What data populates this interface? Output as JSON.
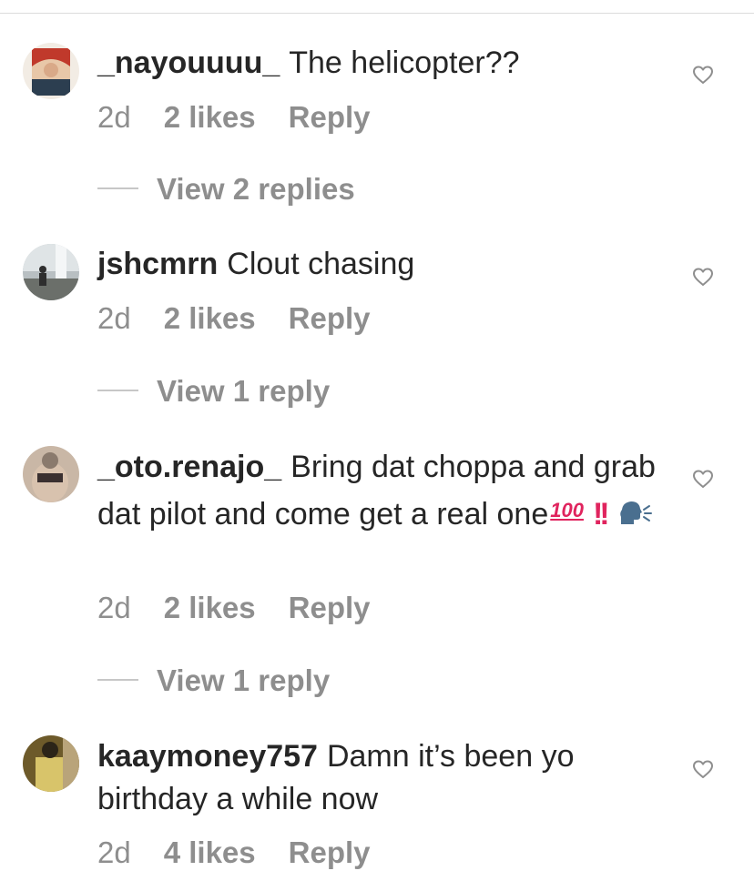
{
  "comments": [
    {
      "username": "_nayouuuu_",
      "text": "The helicopter??",
      "time": "2d",
      "likes": "2 likes",
      "reply": "Reply",
      "view_replies": "View 2 replies",
      "avatar_colors": [
        "#f2ece4",
        "#c0392b",
        "#e8c7a8"
      ]
    },
    {
      "username": "jshcmrn",
      "text": "Clout chasing",
      "time": "2d",
      "likes": "2 likes",
      "reply": "Reply",
      "view_replies": "View 1 reply",
      "avatar_colors": [
        "#b8bfc2",
        "#6b6f6a",
        "#2e2e2e"
      ]
    },
    {
      "username": "_oto.renajo_",
      "text": "Bring dat choppa and grab dat pilot and come get a real one",
      "emoji_100": "100",
      "emoji_bang": "!!",
      "time": "2d",
      "likes": "2 likes",
      "reply": "Reply",
      "view_replies": "View 1 reply",
      "avatar_colors": [
        "#c9b7a6",
        "#8a7a6d",
        "#3a3030"
      ]
    },
    {
      "username": "kaaymoney757",
      "text": "Damn it’s been yo birthday a while now",
      "time": "2d",
      "likes": "4 likes",
      "reply": "Reply",
      "avatar_colors": [
        "#d8c46a",
        "#6d5a2a",
        "#2b2418"
      ]
    }
  ],
  "icons": {
    "like": "heart-outline-icon",
    "speaking_head": "speaking-head-emoji"
  },
  "colors": {
    "primary_text": "#262626",
    "secondary_text": "#8e8e8e",
    "emoji_red": "#e0245e"
  }
}
